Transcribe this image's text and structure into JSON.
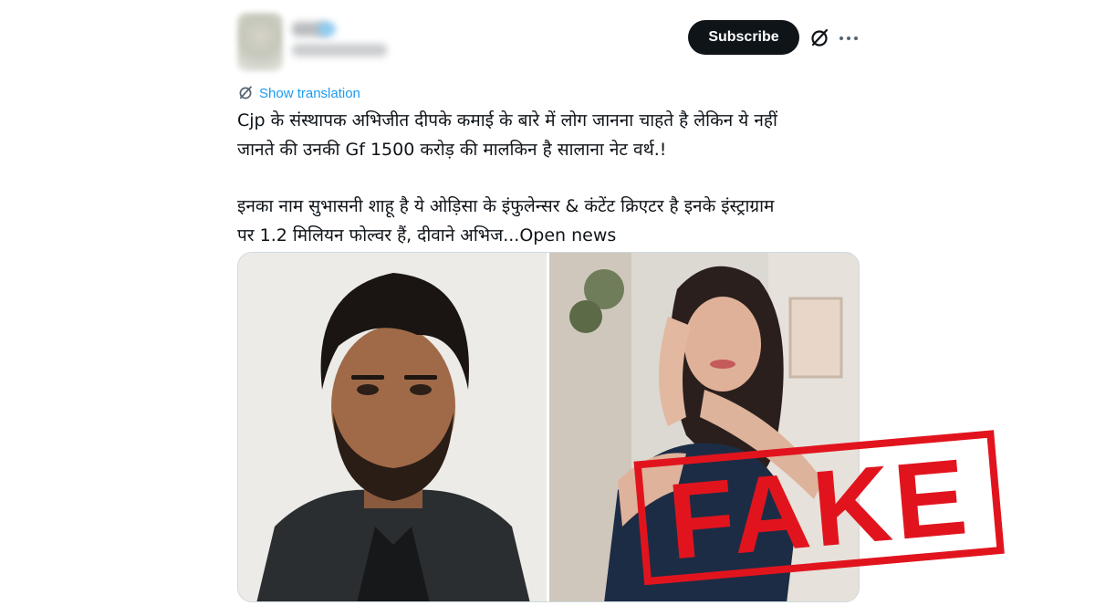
{
  "header": {
    "subscribe_label": "Subscribe",
    "grok_icon": "grok-icon",
    "more_icon": "more-dots-icon"
  },
  "translation": {
    "icon": "translate-icon",
    "label": "Show translation"
  },
  "tweet": {
    "line1": "Cjp के संस्थापक अभिजीत दीपके कमाई के बारे में लोग जानना चाहते है लेकिन ये नहीं",
    "line2": "जानते की उनकी Gf 1500 करोड़ की मालकिन है सालाना नेट वर्थ.!",
    "line3": "इनका नाम सुभासनी शाहू है ये ओड़िसा के इंफुलेन्सर & कंटेंट क्रिएटर है इनके इंस्ट्राग्राम",
    "line4_prefix": "पर 1.2 मिलियन फोल्वर हैं, दीवाने अभिज...",
    "open_news": "Open news"
  },
  "stamp": {
    "text": "FAKE",
    "color": "#e1141e"
  },
  "colors": {
    "accent": "#1d9bf0",
    "text": "#0f1419",
    "button_bg": "#0f1419"
  }
}
